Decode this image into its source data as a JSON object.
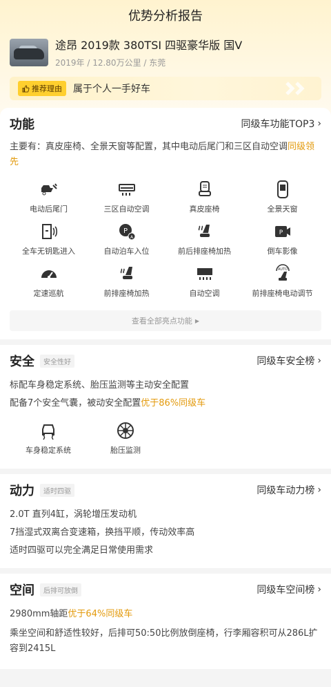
{
  "header": {
    "title": "优势分析报告"
  },
  "car": {
    "name": "途昂 2019款 380TSI 四驱豪华版 国V",
    "meta": "2019年 / 12.80万公里 / 东莞"
  },
  "reason": {
    "tag": "推荐理由",
    "text": "属于个人一手好车"
  },
  "function": {
    "title": "功能",
    "link": "同级车功能TOP3",
    "desc_prefix": "主要有：真皮座椅、全景天窗等配置，其中电动后尾门和三区自动空调",
    "desc_highlight": "同级领先",
    "items": [
      {
        "label": "电动后尾门",
        "icon": "tailgate-icon"
      },
      {
        "label": "三区自动空调",
        "icon": "ac-icon"
      },
      {
        "label": "真皮座椅",
        "icon": "leather-seat-icon"
      },
      {
        "label": "全景天窗",
        "icon": "sunroof-icon"
      },
      {
        "label": "全车无钥匙进入",
        "icon": "keyless-icon"
      },
      {
        "label": "自动泊车入位",
        "icon": "auto-park-icon"
      },
      {
        "label": "前后排座椅加热",
        "icon": "seat-heat-icon"
      },
      {
        "label": "倒车影像",
        "icon": "reverse-camera-icon"
      },
      {
        "label": "定速巡航",
        "icon": "cruise-icon"
      },
      {
        "label": "前排座椅加热",
        "icon": "front-seat-heat-icon"
      },
      {
        "label": "自动空调",
        "icon": "auto-ac-icon"
      },
      {
        "label": "前排座椅电动调节",
        "icon": "power-seat-icon"
      }
    ],
    "more": "查看全部亮点功能"
  },
  "safety": {
    "title": "安全",
    "badge": "安全性好",
    "link": "同级车安全榜",
    "line1": "标配车身稳定系统、胎压监测等主动安全配置",
    "line2_prefix": "配备7个安全气囊，被动安全配置",
    "line2_highlight": "优于86%同级车",
    "items": [
      {
        "label": "车身稳定系统",
        "icon": "stability-icon"
      },
      {
        "label": "胎压监测",
        "icon": "tire-pressure-icon"
      }
    ]
  },
  "power": {
    "title": "动力",
    "badge": "适时四驱",
    "link": "同级车动力榜",
    "lines": [
      "2.0T 直列4缸，涡轮增压发动机",
      "7挡湿式双离合变速箱，换挡平顺，传动效率高",
      "适时四驱可以完全满足日常使用需求"
    ]
  },
  "space": {
    "title": "空间",
    "badge": "后排可放倒",
    "link": "同级车空间榜",
    "line1_prefix": "2980mm轴距",
    "line1_highlight": "优于64%同级车",
    "line2": "乘坐空间和舒适性较好，后排可50:50比例放倒座椅，行李厢容积可从286L扩容到2415L"
  },
  "colors": {
    "accent": "#e39a0c",
    "tag": "#ffcf2e"
  }
}
